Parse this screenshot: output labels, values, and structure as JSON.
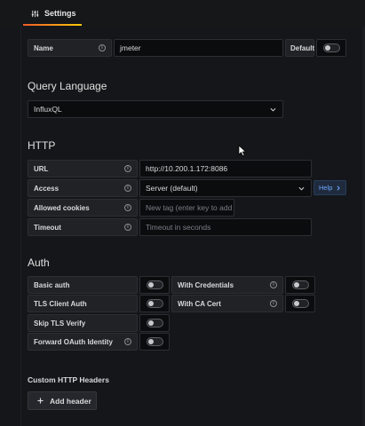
{
  "tabs": {
    "settings": "Settings"
  },
  "name": {
    "label": "Name",
    "value": "jmeter",
    "default_label": "Default"
  },
  "query_language": {
    "heading": "Query Language",
    "value": "InfluxQL"
  },
  "http": {
    "heading": "HTTP",
    "url": {
      "label": "URL",
      "value": "http://10.200.1.172:8086"
    },
    "access": {
      "label": "Access",
      "value": "Server (default)",
      "help": "Help"
    },
    "allowed_cookies": {
      "label": "Allowed cookies",
      "placeholder": "New tag (enter key to add"
    },
    "timeout": {
      "label": "Timeout",
      "placeholder": "Timeout in seconds"
    }
  },
  "auth": {
    "heading": "Auth",
    "basic_auth": "Basic auth",
    "with_credentials": "With Credentials",
    "tls_client_auth": "TLS Client Auth",
    "with_ca_cert": "With CA Cert",
    "skip_tls_verify": "Skip TLS Verify",
    "forward_oauth_identity": "Forward OAuth Identity"
  },
  "custom_headers": {
    "heading": "Custom HTTP Headers",
    "add_label": "Add header"
  },
  "colors": {
    "accent_start": "#f05a28",
    "accent_end": "#fbca0a",
    "link": "#6ea6ff"
  }
}
